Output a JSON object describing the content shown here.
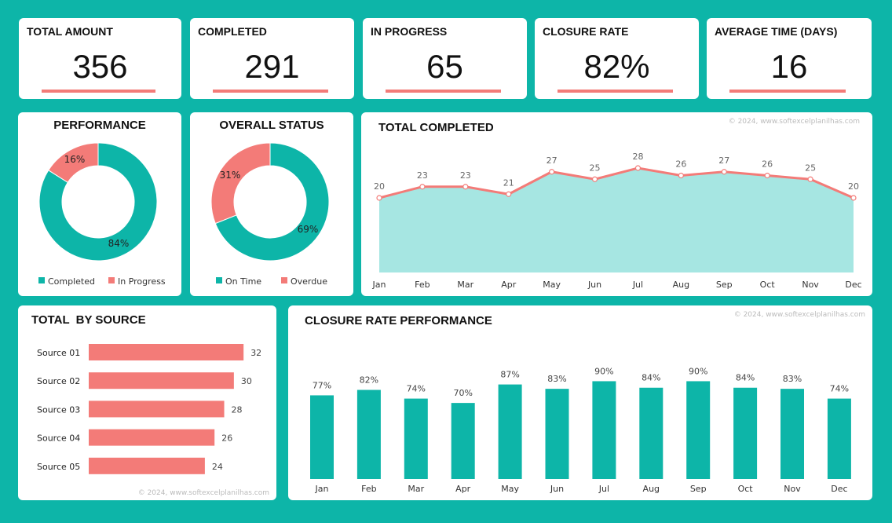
{
  "colors": {
    "background": "#0db5a8",
    "teal": "#0db5a8",
    "coral": "#f37b78",
    "area_fill": "#a6e6e2"
  },
  "kpis": [
    {
      "title": "TOTAL AMOUNT",
      "value": "356"
    },
    {
      "title": "COMPLETED",
      "value": "291"
    },
    {
      "title": "IN PROGRESS",
      "value": "65"
    },
    {
      "title": "CLOSURE RATE",
      "value": "82%"
    },
    {
      "title": "AVERAGE TIME (DAYS)",
      "value": "16"
    }
  ],
  "credit": "© 2024, www.softexcelplanilhas.com",
  "chart_data": [
    {
      "id": "performance",
      "type": "pie",
      "title": "PERFORMANCE",
      "labels": [
        "Completed",
        "In Progress"
      ],
      "values": [
        84,
        16
      ],
      "value_labels": [
        "84%",
        "16%"
      ],
      "colors": [
        "#0db5a8",
        "#f37b78"
      ],
      "legend": "bottom"
    },
    {
      "id": "overall_status",
      "type": "pie",
      "title": "OVERALL STATUS",
      "labels": [
        "On Time",
        "Overdue"
      ],
      "values": [
        69,
        31
      ],
      "value_labels": [
        "69%",
        "31%"
      ],
      "colors": [
        "#0db5a8",
        "#f37b78"
      ],
      "legend": "bottom"
    },
    {
      "id": "total_completed",
      "type": "area",
      "title": "TOTAL COMPLETED",
      "categories": [
        "Jan",
        "Feb",
        "Mar",
        "Apr",
        "May",
        "Jun",
        "Jul",
        "Aug",
        "Sep",
        "Oct",
        "Nov",
        "Dec"
      ],
      "values": [
        20,
        23,
        23,
        21,
        27,
        25,
        28,
        26,
        27,
        26,
        25,
        20
      ],
      "line_color": "#f37b78",
      "fill_color": "#a6e6e2",
      "ylim": [
        0,
        32
      ]
    },
    {
      "id": "total_by_source",
      "type": "bar",
      "orientation": "horizontal",
      "title": "TOTAL  BY SOURCE",
      "categories": [
        "Source 01",
        "Source 02",
        "Source 03",
        "Source 04",
        "Source 05"
      ],
      "values": [
        32,
        30,
        28,
        26,
        24
      ],
      "color": "#f37b78",
      "xlim": [
        0,
        37
      ]
    },
    {
      "id": "closure_rate_performance",
      "type": "bar",
      "title": "CLOSURE RATE PERFORMANCE",
      "categories": [
        "Jan",
        "Feb",
        "Mar",
        "Apr",
        "May",
        "Jun",
        "Jul",
        "Aug",
        "Sep",
        "Oct",
        "Nov",
        "Dec"
      ],
      "values": [
        77,
        82,
        74,
        70,
        87,
        83,
        90,
        84,
        90,
        84,
        83,
        74
      ],
      "value_labels": [
        "77%",
        "82%",
        "74%",
        "70%",
        "87%",
        "83%",
        "90%",
        "84%",
        "90%",
        "84%",
        "83%",
        "74%"
      ],
      "color": "#0db5a8",
      "ylim": [
        0,
        125
      ]
    }
  ]
}
